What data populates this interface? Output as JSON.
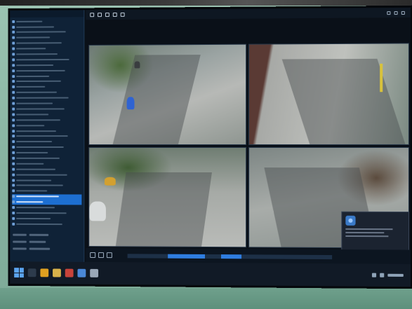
{
  "app": {
    "title": ""
  },
  "sidebar": {
    "items": [
      {
        "label": "",
        "selected": false
      },
      {
        "label": "",
        "selected": false
      },
      {
        "label": "",
        "selected": false
      },
      {
        "label": "",
        "selected": false
      },
      {
        "label": "",
        "selected": false
      },
      {
        "label": "",
        "selected": false
      },
      {
        "label": "",
        "selected": false
      },
      {
        "label": "",
        "selected": false
      },
      {
        "label": "",
        "selected": false
      },
      {
        "label": "",
        "selected": false
      },
      {
        "label": "",
        "selected": false
      },
      {
        "label": "",
        "selected": false
      },
      {
        "label": "",
        "selected": false
      },
      {
        "label": "",
        "selected": false
      },
      {
        "label": "",
        "selected": false
      },
      {
        "label": "",
        "selected": false
      },
      {
        "label": "",
        "selected": false
      },
      {
        "label": "",
        "selected": false
      },
      {
        "label": "",
        "selected": false
      },
      {
        "label": "",
        "selected": false
      },
      {
        "label": "",
        "selected": false
      },
      {
        "label": "",
        "selected": false
      },
      {
        "label": "",
        "selected": false
      },
      {
        "label": "",
        "selected": false
      },
      {
        "label": "",
        "selected": false
      },
      {
        "label": "",
        "selected": false
      },
      {
        "label": "",
        "selected": false
      },
      {
        "label": "",
        "selected": false
      },
      {
        "label": "",
        "selected": false
      },
      {
        "label": "",
        "selected": false
      },
      {
        "label": "",
        "selected": false
      },
      {
        "label": "",
        "selected": false
      },
      {
        "label": "",
        "selected": true
      },
      {
        "label": "",
        "selected": true
      },
      {
        "label": "",
        "selected": false
      },
      {
        "label": "",
        "selected": false
      },
      {
        "label": "",
        "selected": false
      },
      {
        "label": "",
        "selected": false
      }
    ]
  },
  "cameras": [
    {
      "label": ""
    },
    {
      "label": ""
    },
    {
      "label": ""
    },
    {
      "label": ""
    }
  ],
  "notification": {
    "title": "",
    "body": "",
    "primary_button": "",
    "secondary_button": ""
  },
  "colors": {
    "selection": "#1d6fd1",
    "timeline_segment": "#2f7de0",
    "sidebar_bg": "#0f2237"
  }
}
